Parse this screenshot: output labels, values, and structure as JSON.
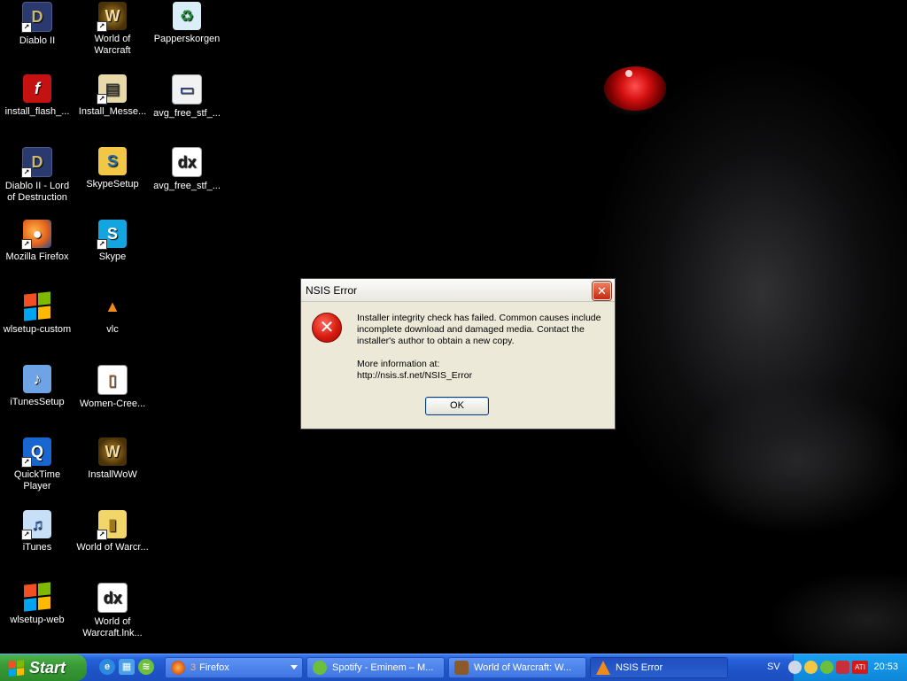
{
  "desktop": {
    "icons": [
      {
        "label": "Diablo II",
        "glyph": "D"
      },
      {
        "label": "World of Warcraft",
        "glyph": "W"
      },
      {
        "label": "Papperskorgen",
        "glyph": "♻"
      },
      {
        "label": "install_flash_...",
        "glyph": "f"
      },
      {
        "label": "Install_Messe...",
        "glyph": "▤"
      },
      {
        "label": "avg_free_stf_...",
        "glyph": "▭"
      },
      {
        "label": "Diablo II - Lord of Destruction",
        "glyph": "D"
      },
      {
        "label": "SkypeSetup",
        "glyph": "S"
      },
      {
        "label": "avg_free_stf_...",
        "glyph": "dx"
      },
      {
        "label": "Mozilla Firefox",
        "glyph": "🦊"
      },
      {
        "label": "Skype",
        "glyph": "S"
      },
      {
        "label": "wlsetup-custom",
        "glyph": ""
      },
      {
        "label": "vlc",
        "glyph": "▲"
      },
      {
        "label": "iTunesSetup",
        "glyph": "♪"
      },
      {
        "label": "Women-Cree...",
        "glyph": "▯"
      },
      {
        "label": "QuickTime Player",
        "glyph": "Q"
      },
      {
        "label": "InstallWoW",
        "glyph": "W"
      },
      {
        "label": "iTunes",
        "glyph": "♫"
      },
      {
        "label": "World of Warcr...",
        "glyph": "▮"
      },
      {
        "label": "wlsetup-web",
        "glyph": ""
      },
      {
        "label": "World of Warcraft.lnk...",
        "glyph": "dx"
      }
    ]
  },
  "dialog": {
    "title": "NSIS Error",
    "close_glyph": "✕",
    "error_glyph": "✕",
    "message": "Installer integrity check has failed. Common causes include incomplete download and damaged media. Contact the installer's author to obtain a new copy.",
    "more_info_label": "More information at:",
    "more_info_url": "http://nsis.sf.net/NSIS_Error",
    "ok_label": "OK"
  },
  "taskbar": {
    "start_label": "Start",
    "buttons": [
      {
        "count": "3",
        "label": "Firefox"
      },
      {
        "label": "Spotify - Eminem – M..."
      },
      {
        "label": "World of Warcraft: W..."
      },
      {
        "label": "NSIS Error"
      }
    ],
    "language": "SV",
    "clock": "20:53"
  }
}
